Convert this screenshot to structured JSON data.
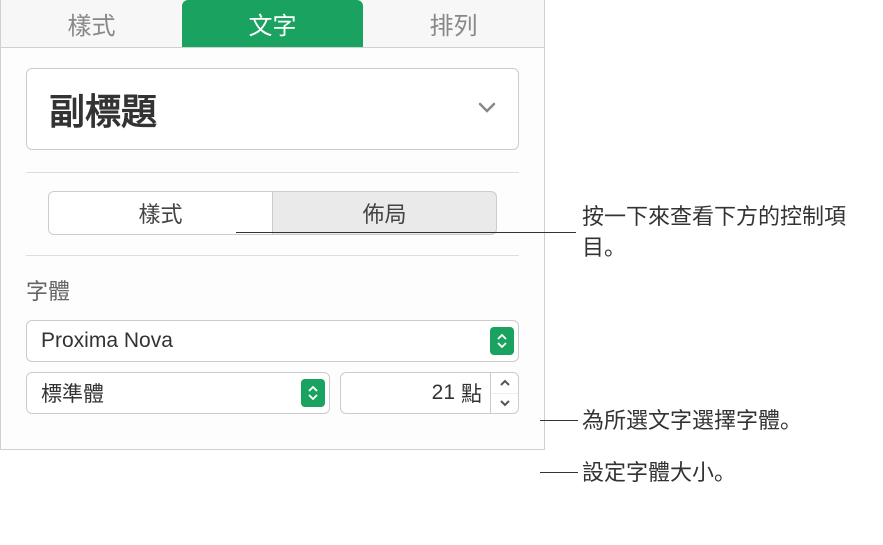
{
  "tabs": {
    "style": "樣式",
    "text": "文字",
    "arrange": "排列"
  },
  "paragraphStyle": {
    "selected": "副標題"
  },
  "segmented": {
    "style": "樣式",
    "layout": "佈局"
  },
  "fontSection": {
    "label": "字體",
    "family": "Proxima Nova",
    "weight": "標準體",
    "size": "21",
    "sizeUnit": "點"
  },
  "callouts": {
    "clickToSee": "按一下來查看下方的控制項目。",
    "chooseFont": "為所選文字選擇字體。",
    "setSize": "設定字體大小。"
  }
}
